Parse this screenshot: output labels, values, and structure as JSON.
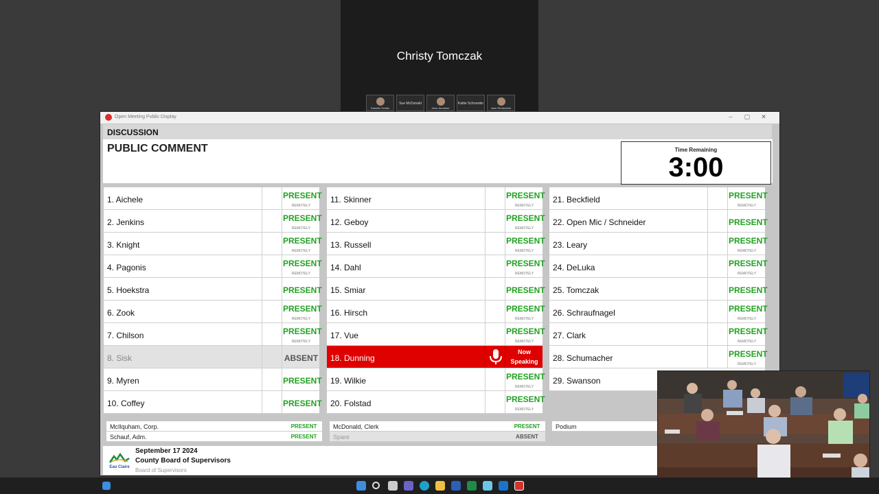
{
  "call": {
    "speaker_name": "Christy Tomczak",
    "thumbnails": [
      {
        "label": "Danielle Dobbs"
      },
      {
        "label": "Sue McDonald"
      },
      {
        "label": "Jane Jemetzer"
      },
      {
        "label": "Kattie Schroeder"
      },
      {
        "label": "Jane Remember"
      }
    ]
  },
  "window": {
    "title": "Open Meeting Public Display",
    "controls": [
      "–",
      "▢",
      "✕"
    ]
  },
  "agenda": {
    "section": "DISCUSSION",
    "item": "PUBLIC COMMENT"
  },
  "timer": {
    "label": "Time Remaining",
    "value": "3:00"
  },
  "columns": [
    [
      {
        "name": "1. Aichele",
        "status": "PRESENT",
        "sub": "REMOTELY"
      },
      {
        "name": "2. Jenkins",
        "status": "PRESENT",
        "sub": "REMOTELY"
      },
      {
        "name": "3. Knight",
        "status": "PRESENT",
        "sub": "REMOTELY"
      },
      {
        "name": "4. Pagonis",
        "status": "PRESENT",
        "sub": "REMOTELY"
      },
      {
        "name": "5. Hoekstra",
        "status": "PRESENT",
        "sub": ""
      },
      {
        "name": "6. Zook",
        "status": "PRESENT",
        "sub": "REMOTELY"
      },
      {
        "name": "7. Chilson",
        "status": "PRESENT",
        "sub": "REMOTELY"
      },
      {
        "name": "8. Sisk",
        "status": "ABSENT",
        "sub": "",
        "state": "absent"
      },
      {
        "name": "9. Myren",
        "status": "PRESENT",
        "sub": ""
      },
      {
        "name": "10. Coffey",
        "status": "PRESENT",
        "sub": ""
      }
    ],
    [
      {
        "name": "11. Skinner",
        "status": "PRESENT",
        "sub": "REMOTELY"
      },
      {
        "name": "12. Geboy",
        "status": "PRESENT",
        "sub": "REMOTELY"
      },
      {
        "name": "13. Russell",
        "status": "PRESENT",
        "sub": "REMOTELY"
      },
      {
        "name": "14. Dahl",
        "status": "PRESENT",
        "sub": "REMOTELY"
      },
      {
        "name": "15. Smiar",
        "status": "PRESENT",
        "sub": ""
      },
      {
        "name": "16. Hirsch",
        "status": "PRESENT",
        "sub": "REMOTELY"
      },
      {
        "name": "17. Vue",
        "status": "PRESENT",
        "sub": "REMOTELY"
      },
      {
        "name": "18. Dunning",
        "status": "Now Speaking",
        "sub": "",
        "state": "speaking"
      },
      {
        "name": "19. Wilkie",
        "status": "PRESENT",
        "sub": "REMOTELY"
      },
      {
        "name": "20. Folstad",
        "status": "PRESENT",
        "sub": "REMOTELY"
      }
    ],
    [
      {
        "name": "21. Beckfield",
        "status": "PRESENT",
        "sub": "REMOTELY"
      },
      {
        "name": "22. Open Mic / Schneider",
        "status": "PRESENT",
        "sub": ""
      },
      {
        "name": "23. Leary",
        "status": "PRESENT",
        "sub": "REMOTELY"
      },
      {
        "name": "24. DeLuka",
        "status": "PRESENT",
        "sub": "REMOTELY"
      },
      {
        "name": "25. Tomczak",
        "status": "PRESENT",
        "sub": ""
      },
      {
        "name": "26. Schraufnagel",
        "status": "PRESENT",
        "sub": "REMOTELY"
      },
      {
        "name": "27. Clark",
        "status": "PRESENT",
        "sub": "REMOTELY"
      },
      {
        "name": "28. Schumacher",
        "status": "PRESENT",
        "sub": "REMOTELY"
      },
      {
        "name": "29. Swanson",
        "status": "",
        "sub": ""
      }
    ]
  ],
  "staff": [
    [
      {
        "name": "McIlquham, Corp.",
        "status": "PRESENT"
      },
      {
        "name": "Schauf, Adm.",
        "status": "PRESENT"
      }
    ],
    [
      {
        "name": "McDonald, Clerk",
        "status": "PRESENT"
      },
      {
        "name": "Spare",
        "status": "ABSENT",
        "state": "absent"
      }
    ],
    [
      {
        "name": "Podium",
        "status": ""
      }
    ]
  ],
  "footer": {
    "date": "September 17 2024",
    "board": "County Board of Supervisors",
    "subtitle": "Board of Supervisors",
    "logo_text": "Eau Claire"
  },
  "taskbar": {
    "icons": [
      "windows-start",
      "search",
      "task-view",
      "teams",
      "edge",
      "file-explorer",
      "word",
      "excel",
      "notepad",
      "outlook",
      "open-meeting-app"
    ]
  },
  "colors": {
    "present": "#22a122",
    "speaking": "#df0000",
    "absent_bg": "#e2e2e2"
  }
}
